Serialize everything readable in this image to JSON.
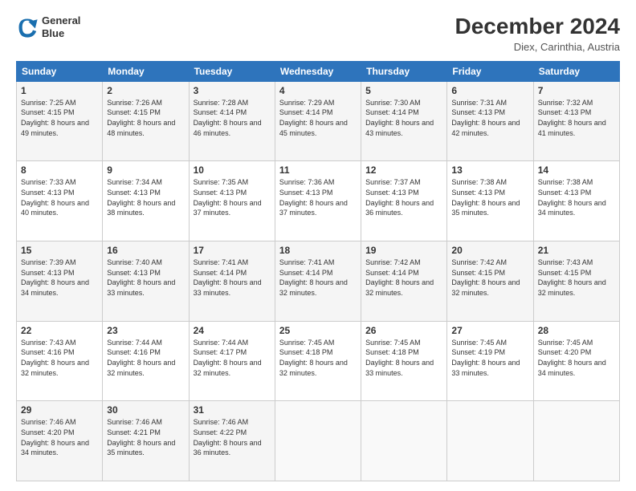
{
  "header": {
    "logo_line1": "General",
    "logo_line2": "Blue",
    "month": "December 2024",
    "location": "Diex, Carinthia, Austria"
  },
  "weekdays": [
    "Sunday",
    "Monday",
    "Tuesday",
    "Wednesday",
    "Thursday",
    "Friday",
    "Saturday"
  ],
  "weeks": [
    [
      {
        "day": "1",
        "sunrise": "7:25 AM",
        "sunset": "4:15 PM",
        "daylight": "8 hours and 49 minutes."
      },
      {
        "day": "2",
        "sunrise": "7:26 AM",
        "sunset": "4:15 PM",
        "daylight": "8 hours and 48 minutes."
      },
      {
        "day": "3",
        "sunrise": "7:28 AM",
        "sunset": "4:14 PM",
        "daylight": "8 hours and 46 minutes."
      },
      {
        "day": "4",
        "sunrise": "7:29 AM",
        "sunset": "4:14 PM",
        "daylight": "8 hours and 45 minutes."
      },
      {
        "day": "5",
        "sunrise": "7:30 AM",
        "sunset": "4:14 PM",
        "daylight": "8 hours and 43 minutes."
      },
      {
        "day": "6",
        "sunrise": "7:31 AM",
        "sunset": "4:13 PM",
        "daylight": "8 hours and 42 minutes."
      },
      {
        "day": "7",
        "sunrise": "7:32 AM",
        "sunset": "4:13 PM",
        "daylight": "8 hours and 41 minutes."
      }
    ],
    [
      {
        "day": "8",
        "sunrise": "7:33 AM",
        "sunset": "4:13 PM",
        "daylight": "8 hours and 40 minutes."
      },
      {
        "day": "9",
        "sunrise": "7:34 AM",
        "sunset": "4:13 PM",
        "daylight": "8 hours and 38 minutes."
      },
      {
        "day": "10",
        "sunrise": "7:35 AM",
        "sunset": "4:13 PM",
        "daylight": "8 hours and 37 minutes."
      },
      {
        "day": "11",
        "sunrise": "7:36 AM",
        "sunset": "4:13 PM",
        "daylight": "8 hours and 37 minutes."
      },
      {
        "day": "12",
        "sunrise": "7:37 AM",
        "sunset": "4:13 PM",
        "daylight": "8 hours and 36 minutes."
      },
      {
        "day": "13",
        "sunrise": "7:38 AM",
        "sunset": "4:13 PM",
        "daylight": "8 hours and 35 minutes."
      },
      {
        "day": "14",
        "sunrise": "7:38 AM",
        "sunset": "4:13 PM",
        "daylight": "8 hours and 34 minutes."
      }
    ],
    [
      {
        "day": "15",
        "sunrise": "7:39 AM",
        "sunset": "4:13 PM",
        "daylight": "8 hours and 34 minutes."
      },
      {
        "day": "16",
        "sunrise": "7:40 AM",
        "sunset": "4:13 PM",
        "daylight": "8 hours and 33 minutes."
      },
      {
        "day": "17",
        "sunrise": "7:41 AM",
        "sunset": "4:14 PM",
        "daylight": "8 hours and 33 minutes."
      },
      {
        "day": "18",
        "sunrise": "7:41 AM",
        "sunset": "4:14 PM",
        "daylight": "8 hours and 32 minutes."
      },
      {
        "day": "19",
        "sunrise": "7:42 AM",
        "sunset": "4:14 PM",
        "daylight": "8 hours and 32 minutes."
      },
      {
        "day": "20",
        "sunrise": "7:42 AM",
        "sunset": "4:15 PM",
        "daylight": "8 hours and 32 minutes."
      },
      {
        "day": "21",
        "sunrise": "7:43 AM",
        "sunset": "4:15 PM",
        "daylight": "8 hours and 32 minutes."
      }
    ],
    [
      {
        "day": "22",
        "sunrise": "7:43 AM",
        "sunset": "4:16 PM",
        "daylight": "8 hours and 32 minutes."
      },
      {
        "day": "23",
        "sunrise": "7:44 AM",
        "sunset": "4:16 PM",
        "daylight": "8 hours and 32 minutes."
      },
      {
        "day": "24",
        "sunrise": "7:44 AM",
        "sunset": "4:17 PM",
        "daylight": "8 hours and 32 minutes."
      },
      {
        "day": "25",
        "sunrise": "7:45 AM",
        "sunset": "4:18 PM",
        "daylight": "8 hours and 32 minutes."
      },
      {
        "day": "26",
        "sunrise": "7:45 AM",
        "sunset": "4:18 PM",
        "daylight": "8 hours and 33 minutes."
      },
      {
        "day": "27",
        "sunrise": "7:45 AM",
        "sunset": "4:19 PM",
        "daylight": "8 hours and 33 minutes."
      },
      {
        "day": "28",
        "sunrise": "7:45 AM",
        "sunset": "4:20 PM",
        "daylight": "8 hours and 34 minutes."
      }
    ],
    [
      {
        "day": "29",
        "sunrise": "7:46 AM",
        "sunset": "4:20 PM",
        "daylight": "8 hours and 34 minutes."
      },
      {
        "day": "30",
        "sunrise": "7:46 AM",
        "sunset": "4:21 PM",
        "daylight": "8 hours and 35 minutes."
      },
      {
        "day": "31",
        "sunrise": "7:46 AM",
        "sunset": "4:22 PM",
        "daylight": "8 hours and 36 minutes."
      },
      null,
      null,
      null,
      null
    ]
  ]
}
